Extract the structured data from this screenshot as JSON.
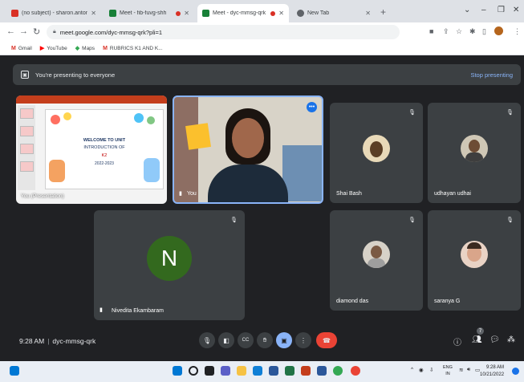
{
  "browser": {
    "tabs": [
      {
        "label": "(no subject) - sharon.antony@gr",
        "favicon_color": "#d93025",
        "active": false,
        "recording": false
      },
      {
        "label": "Meet - fib-fuvg-shh",
        "favicon_color": "#188038",
        "active": false,
        "recording": true
      },
      {
        "label": "Meet - dyc-mmsg-qrk",
        "favicon_color": "#188038",
        "active": true,
        "recording": true
      },
      {
        "label": "New Tab",
        "favicon_color": "#5f6368",
        "active": false,
        "recording": false
      }
    ],
    "new_tab_symbol": "+",
    "url": "meet.google.com/dyc-mmsg-qrk?pli=1",
    "bookmarks": [
      {
        "label": "Gmail",
        "icon": "gmail-icon",
        "color": "#d93025"
      },
      {
        "label": "YouTube",
        "icon": "youtube-icon",
        "color": "#ff0000"
      },
      {
        "label": "Maps",
        "icon": "maps-icon",
        "color": "#34a853"
      },
      {
        "label": "RUBRICS K1 AND K...",
        "icon": "gmail-icon",
        "color": "#d93025"
      }
    ]
  },
  "meet": {
    "presenting_banner": "You're presenting to everyone",
    "stop_presenting": "Stop presenting",
    "presentation": {
      "name": "You (Presentation)",
      "slide_lines": [
        "WELCOME TO UNIT",
        "INTRODUCTION OF",
        "K2",
        "2022-2023"
      ]
    },
    "self_tile": {
      "name": "You"
    },
    "participants": [
      {
        "name": "Shai Bash",
        "avatar": "photo",
        "color": "#6b5b3e"
      },
      {
        "name": "udhayan udhai",
        "avatar": "photo",
        "color": "#8a7560"
      },
      {
        "name": "Nivedita Ekambaram",
        "initial": "N",
        "color": "#33691e"
      },
      {
        "name": "diamond das",
        "avatar": "photo",
        "color": "#7a6a5a"
      },
      {
        "name": "saranya G",
        "avatar": "photo",
        "color": "#c89b86"
      }
    ],
    "time": "9:28 AM",
    "separator": "|",
    "meeting_code": "dyc-mmsg-qrk",
    "participant_count": "7"
  },
  "taskbar": {
    "language": "ENG",
    "region": "IN",
    "time": "9:28 AM",
    "date": "10/21/2022"
  }
}
